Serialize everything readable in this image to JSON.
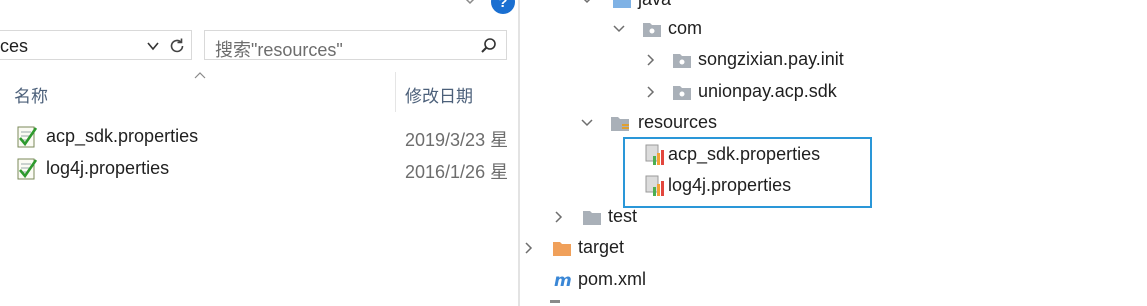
{
  "explorer": {
    "address_text": "ces",
    "search_placeholder": "搜索\"resources\"",
    "columns": {
      "name": "名称",
      "modified": "修改日期"
    },
    "files": [
      {
        "name": "acp_sdk.properties",
        "date": "2019/3/23 星"
      },
      {
        "name": "log4j.properties",
        "date": "2016/1/26 星"
      }
    ]
  },
  "tree": {
    "java_label": "java",
    "com_label": "com",
    "pkg1_label": "songzixian.pay.init",
    "pkg2_label": "unionpay.acp.sdk",
    "resources_label": "resources",
    "res_file1_label": "acp_sdk.properties",
    "res_file2_label": "log4j.properties",
    "test_label": "test",
    "target_label": "target",
    "pom_label": "pom.xml",
    "colors": {
      "folder_gray": "#a9b0b8",
      "folder_blue": "#7fb2e5",
      "target_orange": "#f0a05a",
      "selection_border": "#2a97d8",
      "maven_icon": "#3a87d6"
    }
  }
}
